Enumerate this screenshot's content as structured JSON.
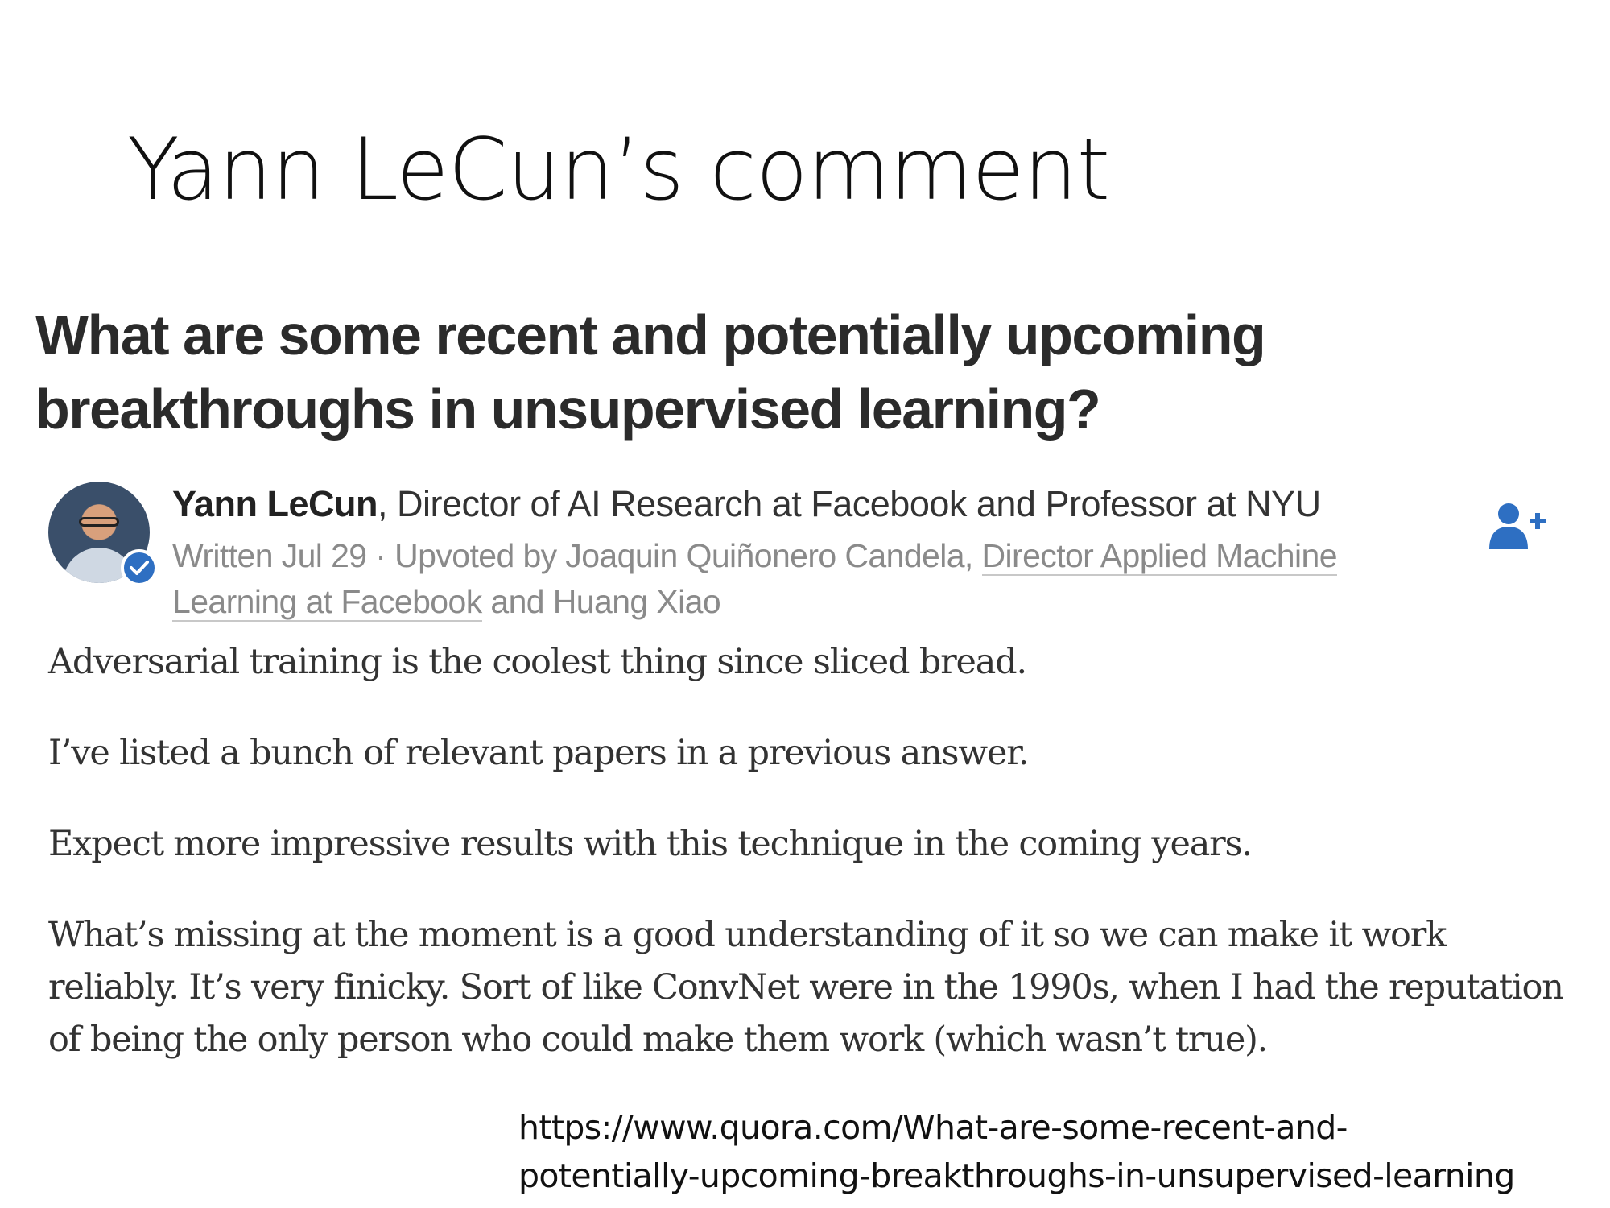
{
  "slide": {
    "title": "Yann LeCun’s comment"
  },
  "question": {
    "text": "What are some recent and potentially upcoming breakthroughs in unsupervised learning?"
  },
  "answer_header": {
    "author_name": "Yann LeCun",
    "author_credential": ", Director of AI Research at Facebook and Professor at NYU",
    "meta_prefix": "Written Jul 29 · Upvoted by Joaquin Quiñonero Candela, ",
    "upvoter_credential": "Director Applied Machine Learning at Facebook",
    "meta_suffix": " and Huang Xiao",
    "avatar_icon": "avatar-photo",
    "verified_icon": "check-icon",
    "follow_icon": "add-user-icon",
    "accent_color": "#2e6fc2"
  },
  "answer_body": {
    "paragraphs": [
      "Adversarial training is the coolest thing since sliced bread.",
      "I’ve listed a bunch of relevant papers in a previous answer.",
      "Expect more impressive results with this technique in the coming years.",
      "What’s missing at the moment is a good understanding of it so we can make it work reliably. It’s very finicky. Sort of like ConvNet were in the 1990s, when I had the reputation of being the only person who could make them work (which wasn’t true)."
    ]
  },
  "source": {
    "url_line1": "https://www.quora.com/What-are-some-recent-and-",
    "url_line2": "potentially-upcoming-breakthroughs-in-unsupervised-learning"
  }
}
